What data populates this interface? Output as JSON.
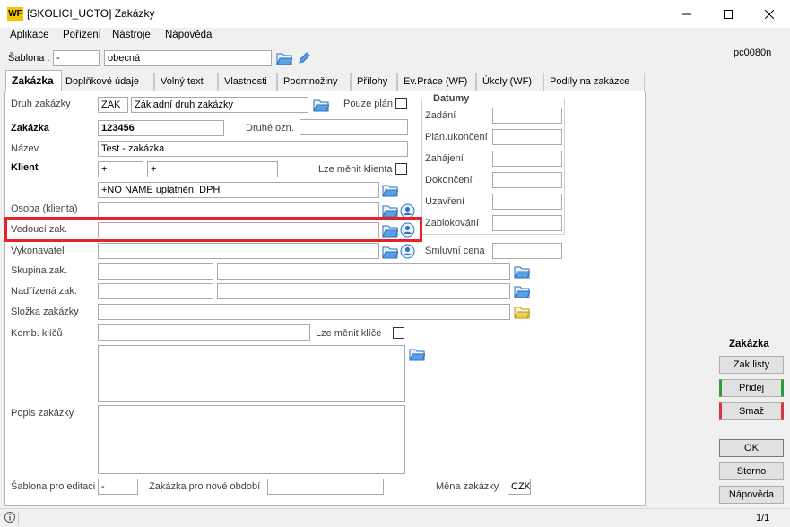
{
  "window": {
    "title": "[SKOLICI_UCTO] Zakázky",
    "logo_text": "WF",
    "controls": [
      "minimize",
      "maximize",
      "close"
    ]
  },
  "menu": [
    "Aplikace",
    "Pořízení",
    "Nástroje",
    "Nápověda"
  ],
  "template": {
    "label": "Šablona :",
    "code": "-",
    "name": "obecná"
  },
  "form_id": "pc0080n",
  "tabs": [
    "Zakázka",
    "Doplňkové údaje",
    "Volný text",
    "Vlastnosti",
    "Podmnožiny",
    "Přílohy",
    "Ev.Práce (WF)",
    "Úkoly (WF)",
    "Podíly na zakázce"
  ],
  "form": {
    "druh_label": "Druh zakázky",
    "druh_code": "ZAK",
    "druh_name": "Základní druh zakázky",
    "pouze_plan_label": "Pouze plán",
    "zakazka_label": "Zakázka",
    "zakazka_value": "123456",
    "druhe_ozn_label": "Druhé ozn.",
    "druhe_ozn_value": "",
    "nazev_label": "Název",
    "nazev_value": "Test - zakázka",
    "klient_label": "Klient",
    "klient_code1": "+",
    "klient_code2": "+",
    "lze_menit_klienta_label": "Lze měnit klienta",
    "klient_name": "+NO NAME uplatnění DPH",
    "osoba_label": "Osoba (klienta)",
    "vedouci_label": "Vedoucí zak.",
    "vykonavatel_label": "Vykonavatel",
    "skupina_label": "Skupina.zak.",
    "nadrizena_label": "Nadřízená zak.",
    "slozka_label": "Složka zakázky",
    "komb_klicu_label": "Komb. klíčů",
    "lze_menit_klice_label": "Lze měnit klíče",
    "popis_label": "Popis zakázky",
    "sablona_editace_label": "Šablona pro editaci",
    "sablona_editace_value": "-",
    "zakazka_nove_obdobi_label": "Zakázka pro nové období",
    "mena_label": "Měna zakázky",
    "mena_value": "CZK"
  },
  "datumy": {
    "title": "Datumy",
    "fields": [
      "Zadání",
      "Plán.ukončení",
      "Zahájení",
      "Dokončení",
      "Uzavření",
      "Zablokování"
    ],
    "smluvni_cena_label": "Smluvní cena"
  },
  "side_panel": {
    "title": "Zakázka",
    "buttons": [
      "Zak.listy",
      "Přidej",
      "Smaž"
    ],
    "ok": "OK",
    "storno": "Storno",
    "napoveda": "Nápověda"
  },
  "status": {
    "info_icon": "info-icon",
    "page": "1/1"
  },
  "colors": {
    "highlight": "#e8202a",
    "add_accent": "#2e9a3a",
    "delete_accent": "#d9383a",
    "logo": "#f5c400"
  }
}
